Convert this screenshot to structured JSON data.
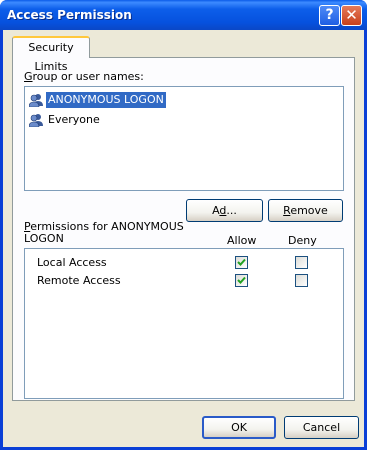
{
  "window": {
    "title": "Access Permission",
    "help_glyph": "?",
    "close_glyph": "✕"
  },
  "tabs": [
    {
      "label": "Security Limits",
      "active": true
    }
  ],
  "groups": {
    "label_prefix": "G",
    "label_rest": "roup or user names:",
    "items": [
      {
        "name": "ANONYMOUS LOGON",
        "selected": true,
        "icon": "user-group-icon"
      },
      {
        "name": "Everyone",
        "selected": false,
        "icon": "user-group-icon"
      }
    ]
  },
  "buttons": {
    "add_prefix": "A",
    "add_ul": "d",
    "add_rest": "d...",
    "remove_ul": "R",
    "remove_rest": "emove",
    "ok": "OK",
    "cancel": "Cancel"
  },
  "permissions": {
    "label_ul": "P",
    "label_line1_rest": "ermissions for ANONYMOUS",
    "label_line2": "LOGON",
    "allow_header": "Allow",
    "deny_header": "Deny",
    "rows": [
      {
        "name": "Local Access",
        "allow": true,
        "deny": false
      },
      {
        "name": "Remote Access",
        "allow": true,
        "deny": false
      }
    ]
  },
  "colors": {
    "titlebar": "#0A5BE8",
    "selection": "#316AC5",
    "dialog_bg": "#ECE9D8",
    "check": "#21A121"
  }
}
